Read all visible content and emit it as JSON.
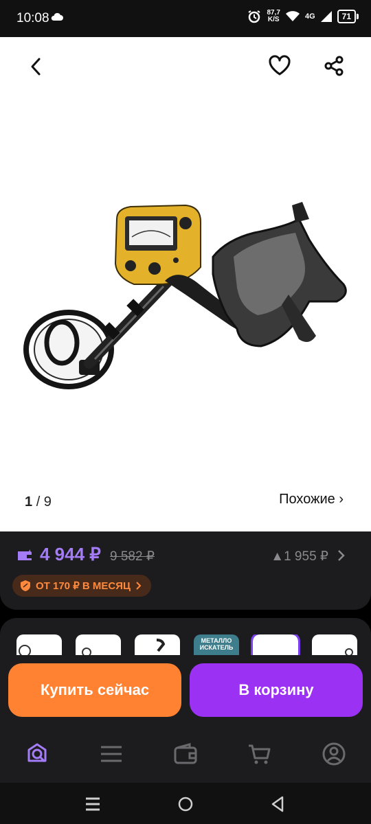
{
  "status_bar": {
    "time": "10:08",
    "speed_value": "87,7",
    "speed_unit": "K/S",
    "network": "4G",
    "battery": "71"
  },
  "photo": {
    "counter_current": "1",
    "counter_total": "/ 9",
    "similar_label": "Похожие ›"
  },
  "price": {
    "current": "4 944 ₽",
    "old": "9 582 ₽",
    "bonus": "▲1 955 ₽",
    "installment": "ОТ 170 ₽ В МЕСЯЦ"
  },
  "thumbnails": [
    {
      "label": "МЕТАЛЛО ИСКАТЕЛЬ"
    }
  ],
  "actions": {
    "buy_now": "Купить сейчас",
    "add_to_cart": "В корзину"
  },
  "tabs": [
    "search-icon",
    "menu-icon",
    "wallet-icon",
    "cart-icon",
    "profile-icon"
  ],
  "colors": {
    "accent": "#9b32f3",
    "buy": "#ff8132",
    "price": "#a47cf7"
  }
}
